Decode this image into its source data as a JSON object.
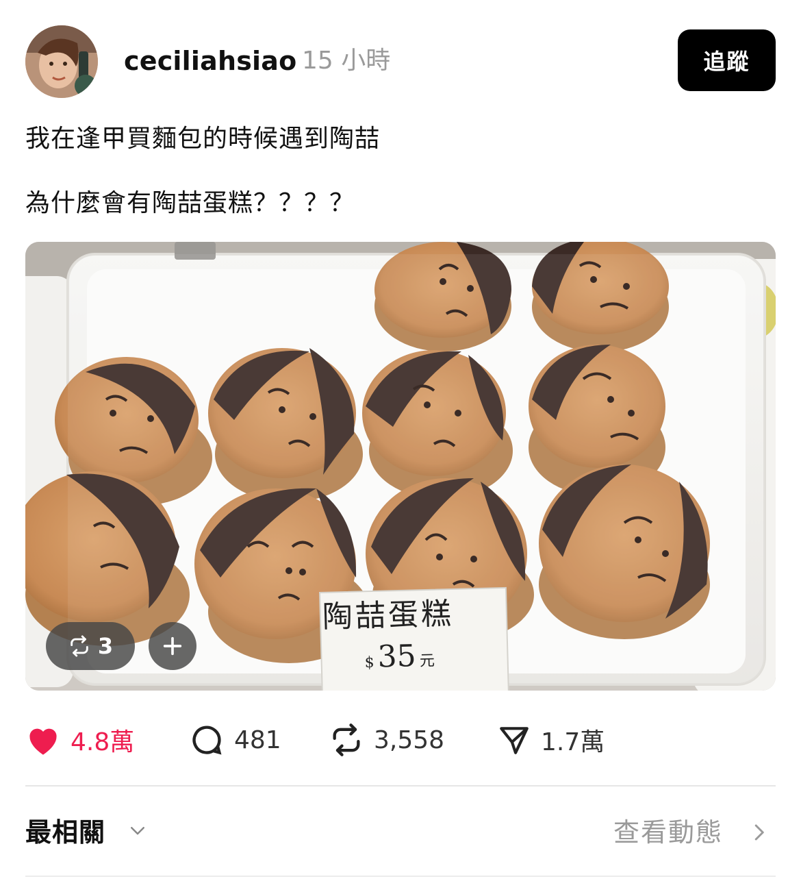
{
  "header": {
    "username": "ceciliahsiao",
    "timestamp": "15 小時",
    "follow_label": "追蹤"
  },
  "post": {
    "lines": [
      "我在逢甲買麵包的時候遇到陶喆",
      "為什麼會有陶喆蛋糕？？？？"
    ],
    "photo": {
      "sign_title": "陶喆蛋糕",
      "sign_price": "35",
      "sign_currency_prefix": "$",
      "sign_unit": "元"
    },
    "repost_count_badge": "3"
  },
  "actions": {
    "likes": "4.8萬",
    "comments": "481",
    "reposts": "3,558",
    "shares": "1.7萬"
  },
  "footer": {
    "sort_label": "最相關",
    "activity_label": "查看動態"
  },
  "colors": {
    "like_red": "#ee1d4f",
    "follow_bg": "#000000",
    "muted": "#9a9a9a"
  },
  "icons": [
    "heart-icon",
    "comment-icon",
    "repost-icon",
    "share-icon",
    "chevron-down-icon",
    "chevron-right-icon",
    "plus-icon"
  ]
}
